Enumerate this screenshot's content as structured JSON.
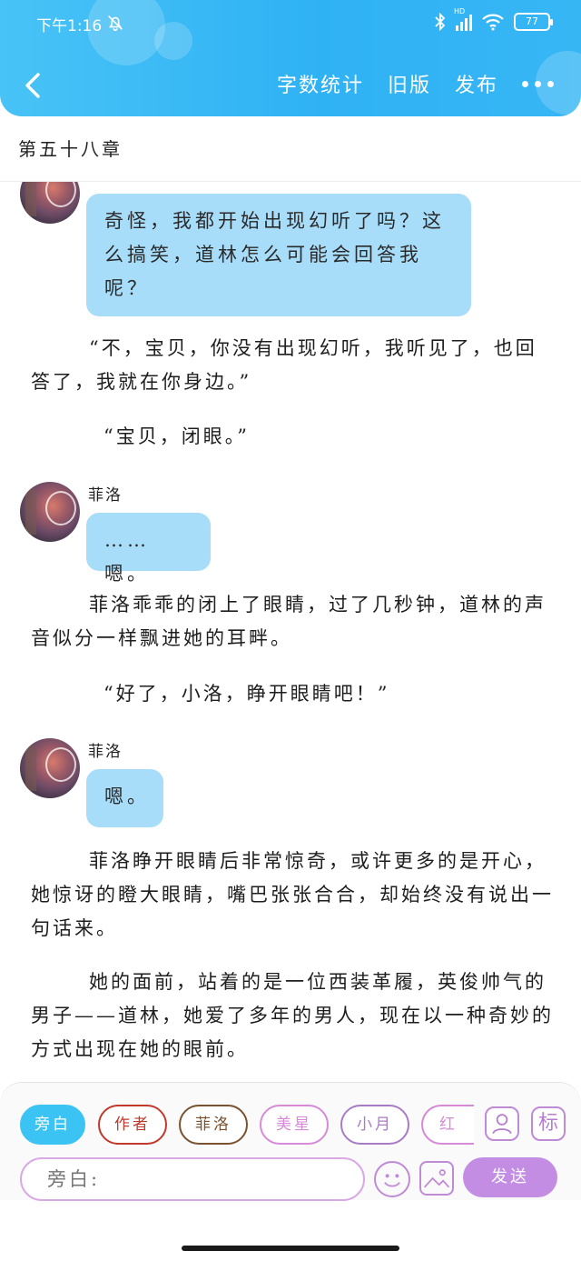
{
  "status_bar": {
    "time": "下午1:16",
    "battery": "77",
    "network": "HD"
  },
  "nav": {
    "word_count_label": "字数统计",
    "old_version_label": "旧版",
    "publish_label": "发布"
  },
  "chapter": {
    "title": "第五十八章"
  },
  "story": {
    "bubble_1": "奇怪，我都开始出现幻听了吗？这么搞笑，道林怎么可能会回答我呢？",
    "para_1": "“不，宝贝，你没有出现幻听，我听见了，也回答了，我就在你身边。”",
    "para_2": "“宝贝，闭眼。”",
    "speaker_2": "菲洛",
    "bubble_2": "……嗯。",
    "para_3": "菲洛乖乖的闭上了眼睛，过了几秒钟，道林的声音似分一样飘进她的耳畔。",
    "para_4": "“好了，小洛，睁开眼睛吧！”",
    "speaker_3": "菲洛",
    "bubble_3": "嗯。",
    "para_5": "菲洛睁开眼睛后非常惊奇，或许更多的是开心，她惊讶的瞪大眼睛，嘴巴张张合合，却始终没有说出一句话来。",
    "para_6": "她的面前，站着的是一位西装革履，英俊帅气的男子——道林，她爱了多年的男人，现在以一种奇妙的方式出现在她的眼前。"
  },
  "roles": [
    {
      "label": "旁白",
      "color": "#3bc3f3"
    },
    {
      "label": "作者",
      "color": "#c0392b"
    },
    {
      "label": "菲洛",
      "color": "#7a5230"
    },
    {
      "label": "美星",
      "color": "#d78ad8"
    },
    {
      "label": "小月",
      "color": "#a77cc6"
    },
    {
      "label": "红叶",
      "color": "#d78ad8"
    }
  ],
  "toolbar": {
    "mark_label": "标"
  },
  "composer": {
    "placeholder": "旁白:",
    "send_label": "发送"
  }
}
